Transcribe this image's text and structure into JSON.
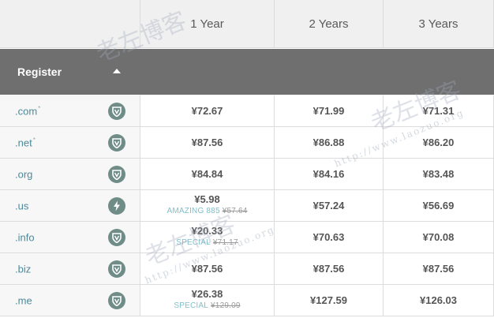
{
  "header": {
    "columns": [
      "",
      "1 Year",
      "2 Years",
      "3 Years"
    ]
  },
  "band": {
    "label": "Register"
  },
  "rows": [
    {
      "tld": ".com",
      "tld_mark": "*",
      "badge": "shield-icon",
      "y1": "¥72.67",
      "y2": "¥71.99",
      "y3": "¥71.31"
    },
    {
      "tld": ".net",
      "tld_mark": "*",
      "badge": "shield-icon",
      "y1": "¥87.56",
      "y2": "¥86.88",
      "y3": "¥86.20"
    },
    {
      "tld": ".org",
      "tld_mark": "",
      "badge": "shield-icon",
      "y1": "¥84.84",
      "y2": "¥84.16",
      "y3": "¥83.48"
    },
    {
      "tld": ".us",
      "tld_mark": "",
      "badge": "lightning-icon",
      "y1": "¥5.98",
      "y1_promo": "AMAZING 885",
      "y1_old": "¥57.64",
      "y2": "¥57.24",
      "y3": "¥56.69"
    },
    {
      "tld": ".info",
      "tld_mark": "",
      "badge": "shield-icon",
      "y1": "¥20.33",
      "y1_promo": "SPECIAL",
      "y1_old": "¥71.17",
      "y2": "¥70.63",
      "y3": "¥70.08"
    },
    {
      "tld": ".biz",
      "tld_mark": "",
      "badge": "shield-icon",
      "y1": "¥87.56",
      "y2": "¥87.56",
      "y3": "¥87.56"
    },
    {
      "tld": ".me",
      "tld_mark": "",
      "badge": "shield-icon",
      "y1": "¥26.38",
      "y1_promo": "SPECIAL",
      "y1_old": "¥129.09",
      "y2": "¥127.59",
      "y3": "¥126.03"
    }
  ],
  "watermark": {
    "text": "老左博客",
    "url": "http://www.laozuo.org"
  }
}
